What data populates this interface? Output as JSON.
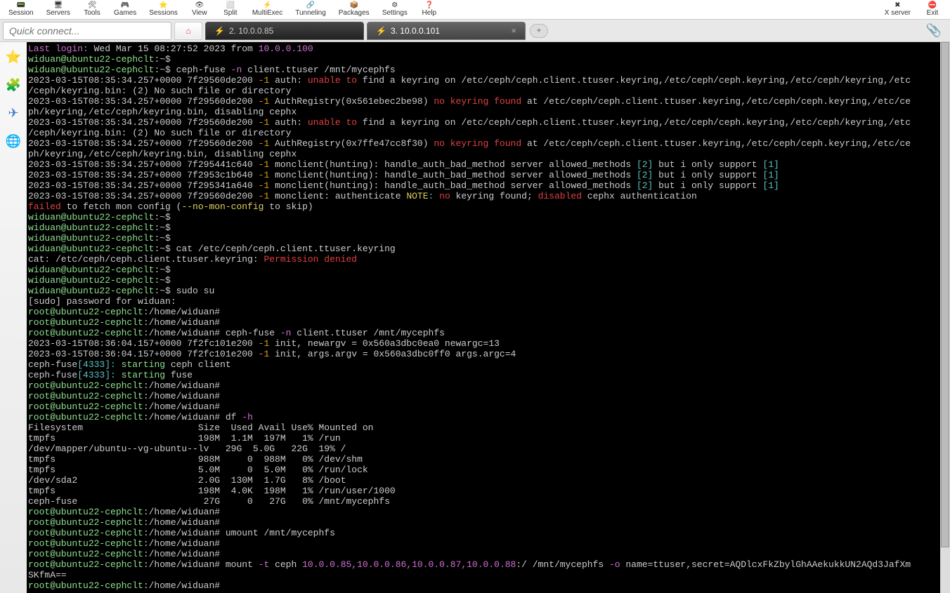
{
  "toolbar": {
    "left": [
      {
        "label": "Session",
        "icon": "📟"
      },
      {
        "label": "Servers",
        "icon": "🖥"
      },
      {
        "label": "Tools",
        "icon": "🛠"
      },
      {
        "label": "Games",
        "icon": "🎮"
      },
      {
        "label": "Sessions",
        "icon": "⭐"
      },
      {
        "label": "View",
        "icon": "👁"
      },
      {
        "label": "Split",
        "icon": "⬜"
      },
      {
        "label": "MultiExec",
        "icon": "⚡"
      },
      {
        "label": "Tunneling",
        "icon": "🔗"
      },
      {
        "label": "Packages",
        "icon": "📦"
      },
      {
        "label": "Settings",
        "icon": "⚙"
      },
      {
        "label": "Help",
        "icon": "❓"
      }
    ],
    "right": [
      {
        "label": "X server",
        "icon": "✖"
      },
      {
        "label": "Exit",
        "icon": "⛔"
      }
    ]
  },
  "quick_connect_placeholder": "Quick connect...",
  "tabs": {
    "inactive_icon": "⚡",
    "inactive_label": "2. 10.0.0.85",
    "active_icon": "⚡",
    "active_label": "3. 10.0.0.101"
  },
  "sidebar_icons": [
    "⭐",
    "🧩",
    "✈",
    "🌐"
  ],
  "term": {
    "last_login": "Last login",
    "last_login_colon": ": ",
    "last_login_date": "Wed Mar 15 08:27:52 2023 from ",
    "last_login_ip": "10.0.0.100",
    "prompt_user": "widuan@ubuntu22-cephclt",
    "prompt_path_user": ":~$",
    "prompt_root": "root@ubuntu22-cephclt",
    "prompt_path_root": ":/home/widuan#",
    "cmd_cephfuse": "ceph-fuse ",
    "flag_n": "-n",
    "flag_t": "-t",
    "flag_h": "-h",
    "flag_o": "-o",
    "val_client": " client.ttuser /mnt/mycephfs",
    "ts1": "2023-03-15T08:35:34.257+0000 7f29560de200 ",
    "ts_c640": "2023-03-15T08:35:34.257+0000 7f295441c640 ",
    "ts_b640": "2023-03-15T08:35:34.257+0000 7f2953c1b640 ",
    "ts_a640": "2023-03-15T08:35:34.257+0000 7f295341a640 ",
    "ts2": "2023-03-15T08:36:04.157+0000 7f2fc101e200 ",
    "neg1": "-1",
    "auth_pre": " auth: ",
    "unable_to": "unable to",
    "auth_find": " find a keyring on /etc/ceph/ceph.client.ttuser.keyring,/etc/ceph/ceph.keyring,/etc/ceph/keyring,/etc",
    "auth_find_l2": "/ceph/keyring.bin: (2) No such file or directory",
    "authreg1": " AuthRegistry(0x561ebec2be98) ",
    "authreg2": " AuthRegistry(0x7ffe47cc8f30) ",
    "no_keyring_found": "no keyring found",
    "at_paths": " at /etc/ceph/ceph.client.ttuser.keyring,/etc/ceph/ceph.keyring,/etc/ce",
    "at_paths_l2": "ph/keyring,/etc/ceph/keyring.bin, disabling cephx",
    "monclient": " monclient(hunting): handle_auth_bad_method server allowed_methods ",
    "brack2": "[2]",
    "brack1": "[1]",
    "but_support": " but i only support ",
    "monauth_pre": " monclient: authenticate ",
    "note": "NOTE",
    "colon_sp": ": ",
    "no": "no",
    "keyring_found_sp": " keyring found; ",
    "disabled": "disabled",
    "cephx_auth": " cephx authentication",
    "failed": "failed",
    "fetch_mon": " to fetch mon config (",
    "no_mon": "--no-mon-config",
    "to_skip": " to skip)",
    "cat_cmd": "cat /etc/ceph/ceph.client.ttuser.keyring",
    "cat_err_pre": "cat: /etc/ceph/ceph.client.ttuser.keyring: ",
    "perm_denied": "Permission denied",
    "sudo_su": "sudo su",
    "sudo_prompt": "[sudo] password for widuan:",
    "init_newargv": " init, newargv = 0x560a3dbc0ea0 newargc=13",
    "init_args": " init, args.argv = 0x560a3dbc0ff0 args.argc=4",
    "cephfuse_pre": "ceph-fuse",
    "brack4333": "[4333]",
    "colon": ": ",
    "starting": "starting",
    "ceph_client": " ceph client",
    "fuse_word": " fuse",
    "df_cmd": "df ",
    "df_header": "Filesystem                     Size  Used Avail Use% Mounted on",
    "df_rows": [
      "tmpfs                          198M  1.1M  197M   1% /run",
      "/dev/mapper/ubuntu--vg-ubuntu--lv   29G  5.0G   22G  19% /",
      "tmpfs                          988M     0  988M   0% /dev/shm",
      "tmpfs                          5.0M     0  5.0M   0% /run/lock",
      "/dev/sda2                      2.0G  130M  1.7G   8% /boot",
      "tmpfs                          198M  4.0K  198M   1% /run/user/1000",
      "ceph-fuse                       27G     0   27G   0% /mnt/mycephfs"
    ],
    "umount_cmd": "umount /mnt/mycephfs",
    "mount_cmd": "mount ",
    "mount_ceph": " ceph ",
    "mount_ips": "10.0.0.85,10.0.0.86,10.0.0.87,10.0.0.88",
    "mount_colon_path": ":/ /mnt/mycephfs ",
    "mount_opts": " name=ttuser,secret=AQDlcxFkZbylGhAAekukkUN2AQd3JafXm",
    "mount_l2": "SKfmA=="
  }
}
